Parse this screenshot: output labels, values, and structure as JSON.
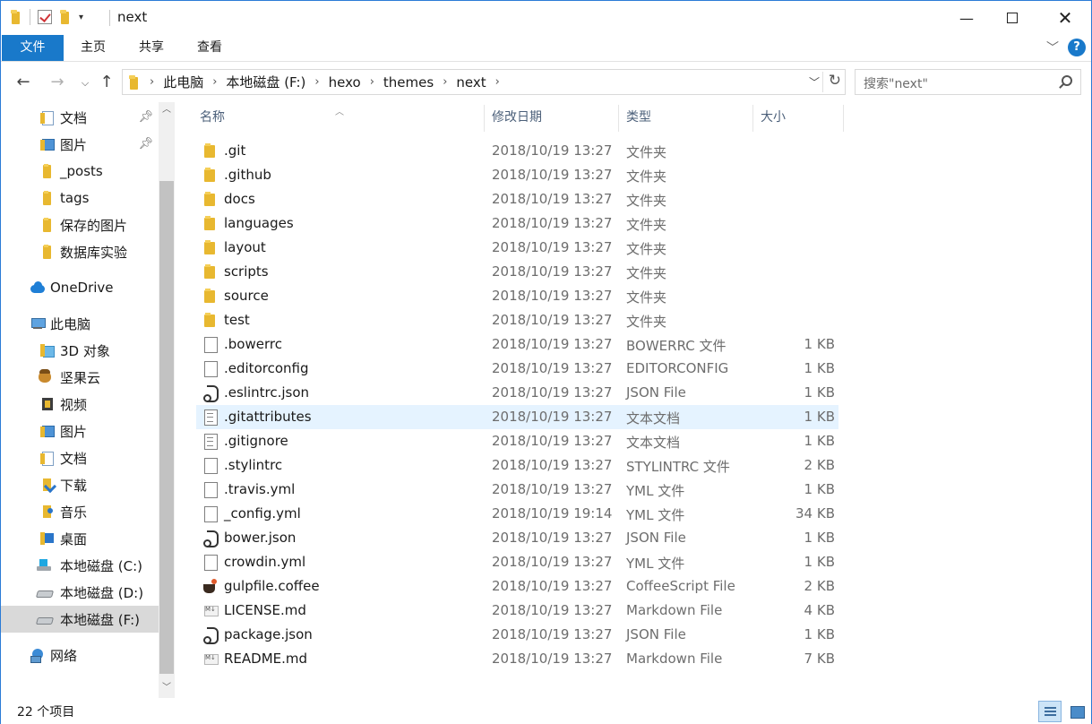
{
  "window": {
    "title": "next"
  },
  "ribbon": {
    "tabs": [
      {
        "label": "文件",
        "active": true
      },
      {
        "label": "主页"
      },
      {
        "label": "共享"
      },
      {
        "label": "查看"
      }
    ],
    "help": "?"
  },
  "address": {
    "crumbs": [
      "此电脑",
      "本地磁盘 (F:)",
      "hexo",
      "themes",
      "next"
    ]
  },
  "search": {
    "placeholder": "搜索\"next\""
  },
  "nav": {
    "items": [
      {
        "label": "文档",
        "icon": "documents-icon",
        "pinned": true
      },
      {
        "label": "图片",
        "icon": "pictures-icon",
        "pinned": true
      },
      {
        "label": "_posts",
        "icon": "folder-icon"
      },
      {
        "label": "tags",
        "icon": "folder-icon"
      },
      {
        "label": "保存的图片",
        "icon": "folder-icon"
      },
      {
        "label": "数据库实验",
        "icon": "folder-icon"
      },
      {
        "label": "OneDrive",
        "icon": "onedrive-cloud-icon"
      },
      {
        "label": "此电脑",
        "icon": "computer-icon"
      },
      {
        "label": "3D 对象",
        "icon": "3d-objects-icon"
      },
      {
        "label": "坚果云",
        "icon": "nutstore-icon"
      },
      {
        "label": "视频",
        "icon": "videos-icon"
      },
      {
        "label": "图片",
        "icon": "pictures-icon"
      },
      {
        "label": "文档",
        "icon": "documents-icon"
      },
      {
        "label": "下载",
        "icon": "downloads-icon"
      },
      {
        "label": "音乐",
        "icon": "music-icon"
      },
      {
        "label": "桌面",
        "icon": "desktop-icon"
      },
      {
        "label": "本地磁盘 (C:)",
        "icon": "windows-drive-icon"
      },
      {
        "label": "本地磁盘 (D:)",
        "icon": "drive-icon"
      },
      {
        "label": "本地磁盘 (F:)",
        "icon": "drive-icon",
        "selected": true
      },
      {
        "label": "网络",
        "icon": "network-icon"
      }
    ]
  },
  "columns": {
    "name": "名称",
    "date": "修改日期",
    "type": "类型",
    "size": "大小"
  },
  "files": [
    {
      "name": ".git",
      "date": "2018/10/19 13:27",
      "type": "文件夹",
      "size": "",
      "icon": "folder-icon"
    },
    {
      "name": ".github",
      "date": "2018/10/19 13:27",
      "type": "文件夹",
      "size": "",
      "icon": "folder-icon"
    },
    {
      "name": "docs",
      "date": "2018/10/19 13:27",
      "type": "文件夹",
      "size": "",
      "icon": "folder-icon"
    },
    {
      "name": "languages",
      "date": "2018/10/19 13:27",
      "type": "文件夹",
      "size": "",
      "icon": "folder-icon"
    },
    {
      "name": "layout",
      "date": "2018/10/19 13:27",
      "type": "文件夹",
      "size": "",
      "icon": "folder-icon"
    },
    {
      "name": "scripts",
      "date": "2018/10/19 13:27",
      "type": "文件夹",
      "size": "",
      "icon": "folder-icon"
    },
    {
      "name": "source",
      "date": "2018/10/19 13:27",
      "type": "文件夹",
      "size": "",
      "icon": "folder-icon"
    },
    {
      "name": "test",
      "date": "2018/10/19 13:27",
      "type": "文件夹",
      "size": "",
      "icon": "folder-icon"
    },
    {
      "name": ".bowerrc",
      "date": "2018/10/19 13:27",
      "type": "BOWERRC 文件",
      "size": "1 KB",
      "icon": "blank-file-icon"
    },
    {
      "name": ".editorconfig",
      "date": "2018/10/19 13:27",
      "type": "EDITORCONFIG",
      "size": "1 KB",
      "icon": "blank-file-icon"
    },
    {
      "name": ".eslintrc.json",
      "date": "2018/10/19 13:27",
      "type": "JSON File",
      "size": "1 KB",
      "icon": "json-file-icon"
    },
    {
      "name": ".gitattributes",
      "date": "2018/10/19 13:27",
      "type": "文本文档",
      "size": "1 KB",
      "icon": "text-file-icon",
      "hover": true
    },
    {
      "name": ".gitignore",
      "date": "2018/10/19 13:27",
      "type": "文本文档",
      "size": "1 KB",
      "icon": "text-file-icon"
    },
    {
      "name": ".stylintrc",
      "date": "2018/10/19 13:27",
      "type": "STYLINTRC 文件",
      "size": "2 KB",
      "icon": "blank-file-icon"
    },
    {
      "name": ".travis.yml",
      "date": "2018/10/19 13:27",
      "type": "YML 文件",
      "size": "1 KB",
      "icon": "blank-file-icon"
    },
    {
      "name": "_config.yml",
      "date": "2018/10/19 19:14",
      "type": "YML 文件",
      "size": "34 KB",
      "icon": "blank-file-icon"
    },
    {
      "name": "bower.json",
      "date": "2018/10/19 13:27",
      "type": "JSON File",
      "size": "1 KB",
      "icon": "json-file-icon"
    },
    {
      "name": "crowdin.yml",
      "date": "2018/10/19 13:27",
      "type": "YML 文件",
      "size": "1 KB",
      "icon": "blank-file-icon"
    },
    {
      "name": "gulpfile.coffee",
      "date": "2018/10/19 13:27",
      "type": "CoffeeScript File",
      "size": "2 KB",
      "icon": "coffee-file-icon"
    },
    {
      "name": "LICENSE.md",
      "date": "2018/10/19 13:27",
      "type": "Markdown File",
      "size": "4 KB",
      "icon": "markdown-file-icon"
    },
    {
      "name": "package.json",
      "date": "2018/10/19 13:27",
      "type": "JSON File",
      "size": "1 KB",
      "icon": "json-file-icon"
    },
    {
      "name": "README.md",
      "date": "2018/10/19 13:27",
      "type": "Markdown File",
      "size": "7 KB",
      "icon": "markdown-file-icon"
    }
  ],
  "status": {
    "count": "22 个项目"
  },
  "colors": {
    "accent": "#1979ca",
    "hover_row": "#e5f3ff",
    "selected_nav": "#d9d9d9",
    "folder": "#e8b830"
  }
}
